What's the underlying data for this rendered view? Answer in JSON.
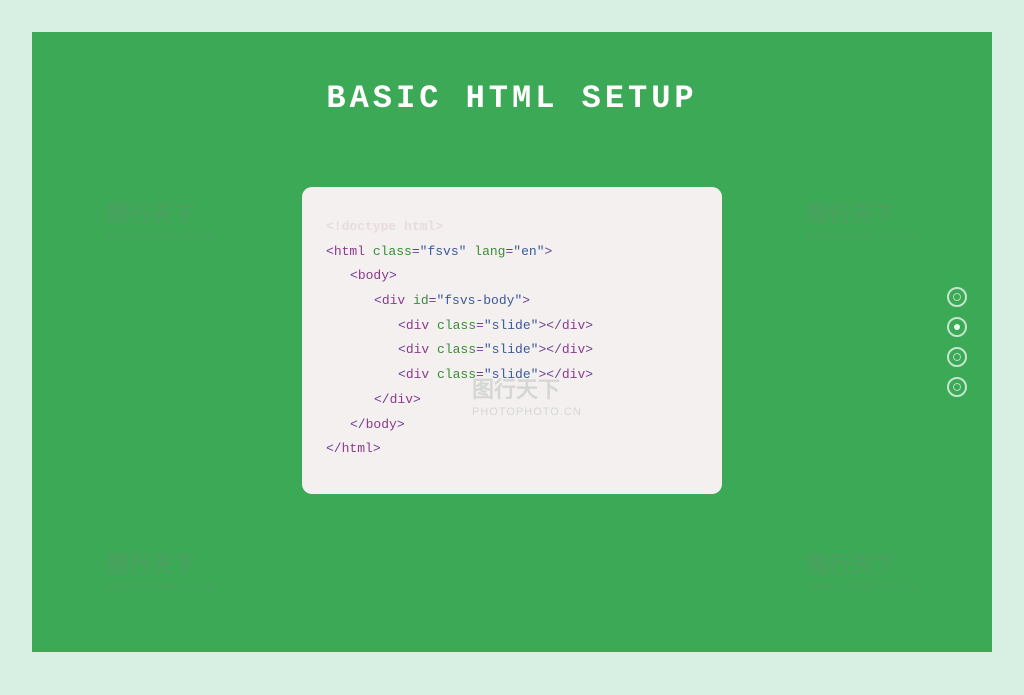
{
  "title": "BASIC HTML SETUP",
  "code": {
    "line0": "<!doctype html>",
    "line1_open": "<",
    "line1_tag": "html",
    "line1_attr1": " class",
    "line1_eq": "=",
    "line1_val1": "\"fsvs\"",
    "line1_attr2": " lang",
    "line1_val2": "\"en\"",
    "line1_close": ">",
    "body_open": "<",
    "body_tag": "body",
    "body_close": ">",
    "div1_open": "<",
    "div_tag": "div",
    "div1_attr": " id",
    "div1_val": "\"fsvs-body\"",
    "div1_close": ">",
    "slide_open": "<",
    "slide_attr": " class",
    "slide_val": "\"slide\"",
    "slide_close": ">",
    "slide_end_open": "</",
    "slide_end_close": ">",
    "div_end_open": "</",
    "div_end_close": ">",
    "body_end_open": "</",
    "body_end_close": ">",
    "html_end_open": "</",
    "html_end_close": ">"
  },
  "navigation": {
    "total_slides": 4,
    "active_index": 1
  },
  "watermark": {
    "line1": "图行天下",
    "line2": "PHOTOPHOTO.CN"
  }
}
